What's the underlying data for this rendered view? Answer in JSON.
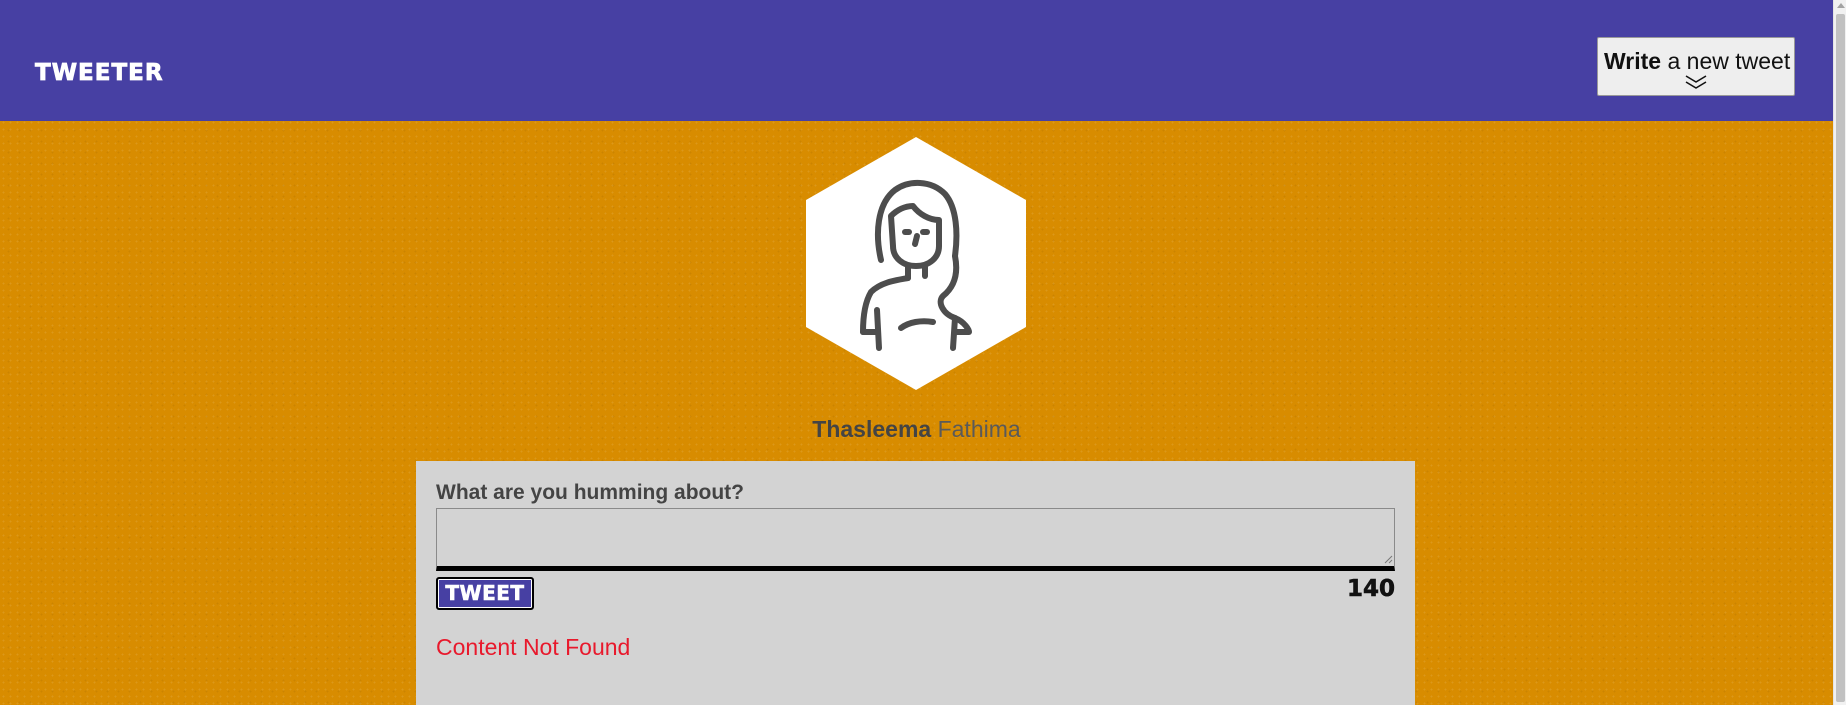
{
  "navbar": {
    "brand": "TWEETER",
    "compose_toggle": {
      "bold_text": "Write",
      "rest_text": "a new tweet",
      "icon": "double-chevron-down-icon"
    }
  },
  "profile": {
    "avatar_icon": "woman-avatar-icon",
    "first_name": "Thasleema",
    "last_name": "Fathima"
  },
  "compose": {
    "label": "What are you humming about?",
    "input_value": "",
    "button_label": "TWEET",
    "counter": "140",
    "error": "Content Not Found"
  },
  "colors": {
    "navbar": "#4740a3",
    "background": "#d88c00",
    "card": "#d3d3d3",
    "error": "#e8192c"
  }
}
